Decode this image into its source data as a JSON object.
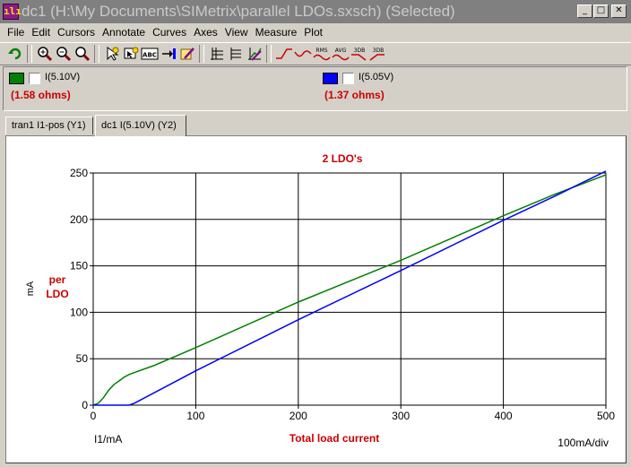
{
  "window": {
    "title": "dc1 (H:\\My Documents\\SIMetrix\\parallel LDOs.sxsch) (Selected)",
    "app_icon_glyph": "ılı",
    "buttons": {
      "minimize": "_",
      "maximize": "□",
      "close": "✕"
    }
  },
  "menu": [
    "File",
    "Edit",
    "Cursors",
    "Annotate",
    "Curves",
    "Axes",
    "View",
    "Measure",
    "Plot"
  ],
  "toolbar": {
    "icons": [
      "undo-arrow-icon",
      "zoom-in-icon",
      "zoom-out-icon",
      "zoom-fit-icon",
      "cursor-icon",
      "cursor-step-icon",
      "annotate-abc-icon",
      "move-curve-icon",
      "edit-icon",
      "axis-grid-icon",
      "axis-stack-icon",
      "axis-auto-icon",
      "rise-icon",
      "rms-icon",
      "avg-icon",
      "3db-low-icon",
      "3db-high-icon"
    ],
    "text_labels": {
      "abc": "ABC",
      "rms": "RMS",
      "avg": "AVG",
      "db1": "3DB",
      "db2": "3DB"
    }
  },
  "legend": [
    {
      "label": "I(5.10V)",
      "value": "(1.58 ohms)",
      "color": "#008000"
    },
    {
      "label": "I(5.05V)",
      "value": "(1.37 ohms)",
      "color": "#0000ff"
    }
  ],
  "tabs": [
    {
      "label": "tran1 I1-pos (Y1)",
      "active": false
    },
    {
      "label": "dc1 I(5.10V) (Y2)",
      "active": true
    }
  ],
  "chart_data": {
    "type": "line",
    "title": "2 LDO's",
    "xlabel": "Total load current",
    "x_unit_label": "I1/mA",
    "x_scale_label": "100mA/div",
    "ylabel": "per LDO",
    "y_unit_label": "mA",
    "xlim": [
      0,
      500
    ],
    "ylim": [
      0,
      250
    ],
    "x_ticks": [
      0,
      100,
      200,
      300,
      400,
      500
    ],
    "y_ticks": [
      0,
      50,
      100,
      150,
      200,
      250
    ],
    "grid": true,
    "series": [
      {
        "name": "I(5.10V)",
        "color": "#008000",
        "x": [
          0,
          5,
          10,
          15,
          20,
          25,
          30,
          35,
          40,
          60,
          100,
          200,
          300,
          400,
          450,
          500
        ],
        "y": [
          0,
          2,
          8,
          16,
          22,
          26,
          30,
          33,
          35,
          43,
          62,
          111,
          156,
          204,
          227,
          248
        ]
      },
      {
        "name": "I(5.05V)",
        "color": "#0000ff",
        "x": [
          0,
          30,
          35,
          40,
          100,
          200,
          300,
          400,
          450,
          500
        ],
        "y": [
          0,
          0,
          0,
          2,
          37,
          92,
          145,
          199,
          225,
          252
        ]
      }
    ]
  }
}
